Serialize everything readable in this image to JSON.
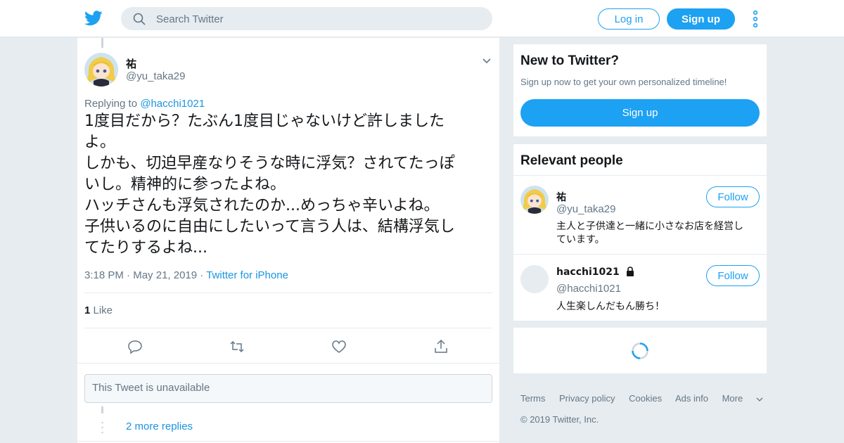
{
  "header": {
    "logo_icon": "twitter-bird-icon",
    "search_placeholder": "Search Twitter",
    "login_label": "Log in",
    "signup_label": "Sign up",
    "brand_color": "#1da1f2"
  },
  "tweet": {
    "author_name": "祐",
    "author_handle": "@yu_taka29",
    "replying_prefix": "Replying to ",
    "replying_to": "@hacchi1021",
    "text": "1度目だから？たぶん1度目じゃないけど許しました\nよ。\nしかも、切迫早産なりそうな時に浮気？されてたっぽ\nいし。精神的に参ったよね。\nハッチさんも浮気されたのか...めっちゃ辛いよね。\n子供いるのに自由にしたいって言う人は、結構浮気し\nてたりするよね...",
    "time": "3:18 PM",
    "date": "May 21, 2019",
    "client": "Twitter for iPhone",
    "like_count": "1",
    "like_label": " Like",
    "actions": [
      "reply-icon",
      "retweet-icon",
      "like-icon",
      "share-icon"
    ]
  },
  "thread": {
    "unavailable_text": "This Tweet is unavailable",
    "more_replies": "2 more replies"
  },
  "sidebar": {
    "new_title": "New to Twitter?",
    "new_sub": "Sign up now to get your own personalized timeline!",
    "signup_label": "Sign up",
    "people_title": "Relevant people",
    "people": [
      {
        "name": "祐",
        "handle": "@yu_taka29",
        "bio": "主人と子供達と一緒に小さなお店を経営し\nています。",
        "follow_label": "Follow",
        "protected": false
      },
      {
        "name": "hacchi1021",
        "handle": "@hacchi1021",
        "bio": "人生楽しんだもん勝ち！",
        "follow_label": "Follow",
        "protected": true
      }
    ]
  },
  "footer": {
    "links": [
      "Terms",
      "Privacy policy",
      "Cookies",
      "Ads info",
      "More"
    ],
    "copyright": "© 2019 Twitter, Inc."
  }
}
